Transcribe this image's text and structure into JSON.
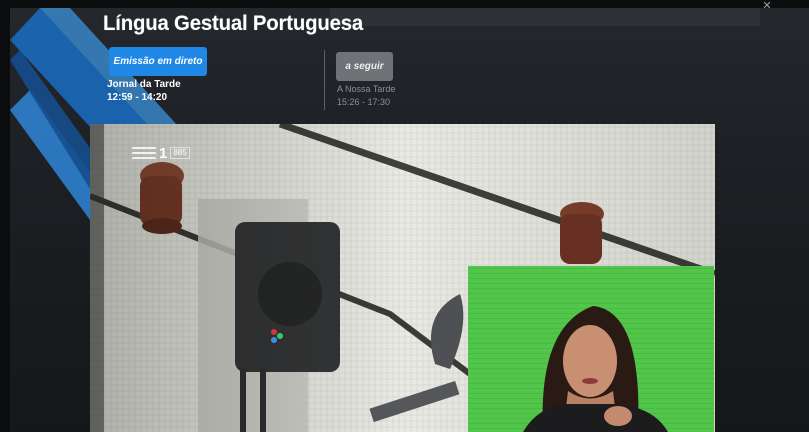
{
  "page": {
    "title": "Língua Gestual Portuguesa"
  },
  "now": {
    "live_label": "Emissão em direto",
    "program": "Jornal da Tarde",
    "time": "12:59 - 14:20"
  },
  "next": {
    "label": "a seguir",
    "program": "A Nossa Tarde",
    "time": "15:26 - 17:30"
  },
  "channel": {
    "number": "1",
    "code": "885",
    "icon": "rtp-stripes-icon"
  },
  "colors": {
    "accent": "#1f87e6",
    "next_button": "#6f7276",
    "brand_blue": "#1d6fc0",
    "signer_background": "#4fc44a"
  }
}
